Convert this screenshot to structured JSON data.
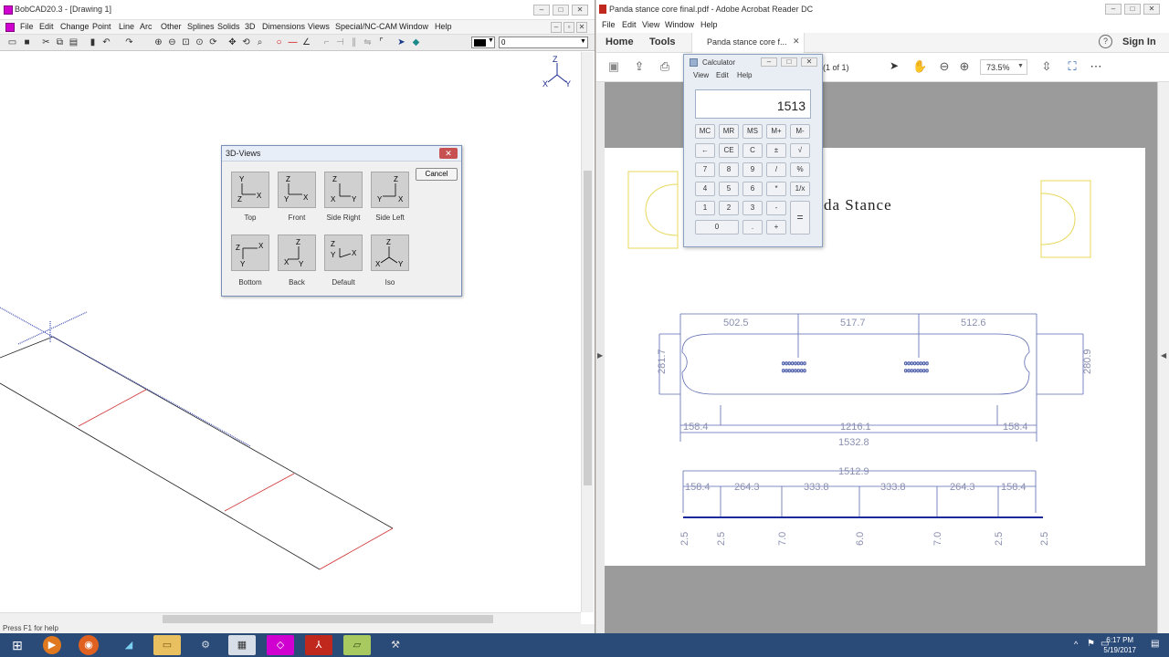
{
  "bobcad": {
    "title": "BobCAD20.3 - [Drawing 1]",
    "menu": [
      "File",
      "Edit",
      "Change",
      "Point",
      "Line",
      "Arc",
      "Other",
      "Splines",
      "Solids",
      "3D",
      "Dimensions",
      "Views",
      "Special/NC-CAM",
      "Window",
      "Help"
    ],
    "toolbar_input_value": "0",
    "status_text": "Press F1 for help",
    "axis_labels": {
      "z": "Z",
      "x": "X",
      "y": "Y"
    }
  },
  "views3d": {
    "title": "3D-Views",
    "cancel_label": "Cancel",
    "buttons": [
      {
        "label": "Top"
      },
      {
        "label": "Front"
      },
      {
        "label": "Side Right"
      },
      {
        "label": "Side Left"
      },
      {
        "label": "Bottom"
      },
      {
        "label": "Back"
      },
      {
        "label": "Default"
      },
      {
        "label": "Iso"
      }
    ]
  },
  "acrobat": {
    "title": "Panda stance core final.pdf - Adobe Acrobat Reader DC",
    "menu": [
      "File",
      "Edit",
      "View",
      "Window",
      "Help"
    ],
    "nav": {
      "home": "Home",
      "tools": "Tools",
      "tab": "Panda stance core f...",
      "help": "?",
      "signin": "Sign In"
    },
    "page_indicator": "(1 of 1)",
    "zoom": "73.5%",
    "doc_title_fragment": "da Stance",
    "dims_top": [
      "502.5",
      "517.7",
      "512.6"
    ],
    "dim_left_height": "281.7",
    "dim_right_height": "280.9",
    "dim_bottom_row": [
      "158.4",
      "1216.1",
      "158.4"
    ],
    "dim_overall": "1532.8",
    "profile_overall": "1512.9",
    "profile_segments": [
      "158.4",
      "264.3",
      "333.8",
      "333.8",
      "264.3",
      "158.4"
    ],
    "profile_thickness": [
      "2.5",
      "2.5",
      "7.0",
      "6.0",
      "7.0",
      "2.5",
      "2.5"
    ]
  },
  "calculator": {
    "title": "Calculator",
    "menu": [
      "View",
      "Edit",
      "Help"
    ],
    "display": "1513",
    "rows": [
      [
        "MC",
        "MR",
        "MS",
        "M+",
        "M-"
      ],
      [
        "←",
        "CE",
        "C",
        "±",
        "√"
      ],
      [
        "7",
        "8",
        "9",
        "/",
        "%"
      ],
      [
        "4",
        "5",
        "6",
        "*",
        "1/x"
      ],
      [
        "1",
        "2",
        "3",
        "-",
        "="
      ],
      [
        "0",
        ".",
        "+"
      ]
    ]
  },
  "taskbar": {
    "time": "6:17 PM",
    "date": "5/19/2017"
  }
}
